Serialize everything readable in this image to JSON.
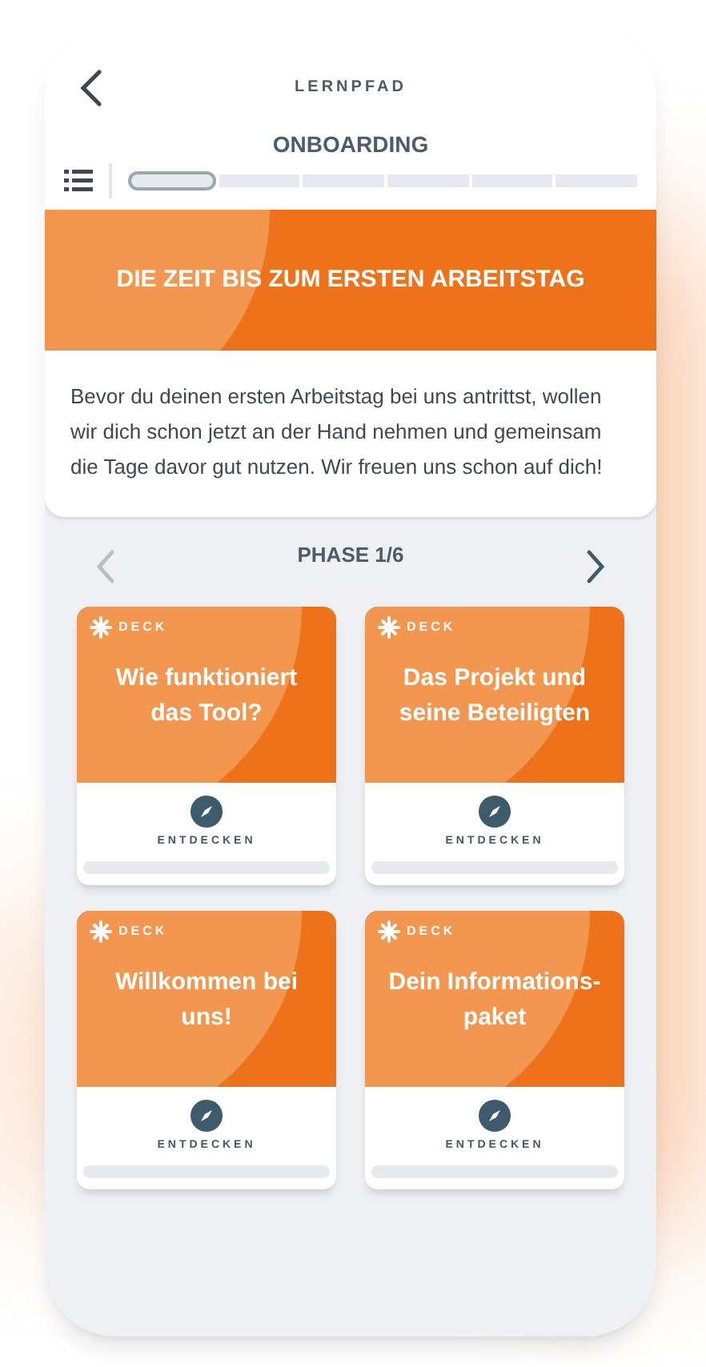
{
  "header": {
    "eyebrow": "LERNPFAD",
    "title": "ONBOARDING"
  },
  "phases": [
    {
      "selected": true
    },
    {
      "selected": false
    },
    {
      "selected": false
    },
    {
      "selected": false
    },
    {
      "selected": false
    },
    {
      "selected": false
    }
  ],
  "banner": {
    "title": "DIE ZEIT BIS ZUM ERSTEN ARBEITSTAG",
    "text": "Bevor du deinen ersten Arbeitstag bei uns antrittst, wollen wir dich schon jetzt an der Hand nehmen und gemeinsam die Tage davor gut nutzen. Wir freuen uns schon auf dich!"
  },
  "pager": {
    "label": "PHASE 1/6",
    "prev_disabled": true,
    "next_disabled": false
  },
  "cards": [
    {
      "tag": "DECK",
      "title": "Wie funktioniert das Tool?",
      "action": "ENTDECKEN",
      "level": 0
    },
    {
      "tag": "DECK",
      "title": "Das Projekt und seine Beteiligten",
      "action": "ENTDECKEN",
      "level": 0
    },
    {
      "tag": "DECK",
      "title": "Willkommen bei uns!",
      "action": "ENTDECKEN",
      "level": 0
    },
    {
      "tag": "DECK",
      "title": "Dein Informations-paket",
      "action": "ENTDECKEN",
      "level": 0
    }
  ]
}
